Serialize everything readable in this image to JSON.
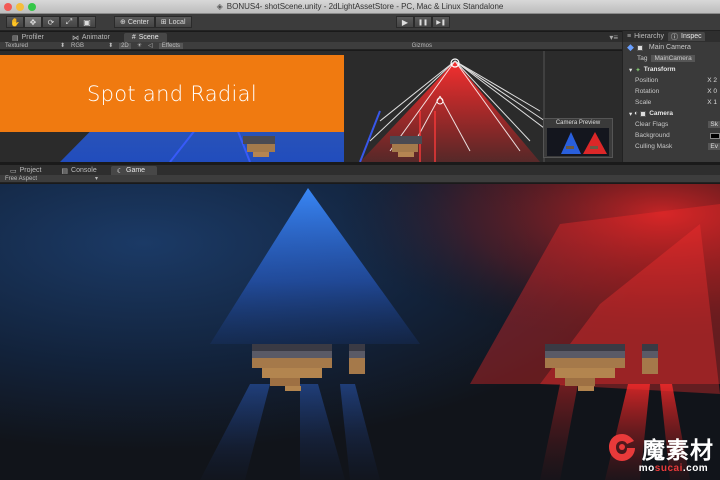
{
  "window": {
    "title": "BONUS4- shotScene.unity - 2dLightAssetStore - PC, Mac & Linux Standalone"
  },
  "toolbar": {
    "tools": [
      "hand-tool",
      "move-tool",
      "rotate-tool",
      "scale-tool",
      "rect-tool"
    ],
    "pivot_label": "Center",
    "space_label": "Local",
    "play_icon": "▶",
    "pause_icon": "❚❚",
    "step_icon": "▶❚"
  },
  "top_tabs": {
    "profiler": "Profiler",
    "animator": "Animator",
    "scene": "Scene"
  },
  "scene_toolbar": {
    "shading": "Textured",
    "render_mode": "RGB",
    "mode_2d": "2D",
    "effects": "Effects",
    "gizmos": "Gizmos"
  },
  "banner": {
    "text": "Spot and Radial"
  },
  "camera_preview": {
    "label": "Camera Preview"
  },
  "right_panel": {
    "tab_hierarchy": "Hierarchy",
    "tab_inspector": "Inspec",
    "object_name": "Main Camera",
    "tag_label": "Tag",
    "tag_value": "MainCamera",
    "transform_label": "Transform",
    "position_label": "Position",
    "position_value": "X 2",
    "rotation_label": "Rotation",
    "rotation_value": "X 0",
    "scale_label": "Scale",
    "scale_value": "X 1",
    "camera_label": "Camera",
    "clear_flags_label": "Clear Flags",
    "clear_flags_value": "Sk",
    "background_label": "Background",
    "culling_mask_label": "Culling Mask",
    "culling_mask_value": "Ev"
  },
  "bottom_tabs": {
    "project": "Project",
    "console": "Console",
    "game": "Game"
  },
  "game_toolbar": {
    "aspect": "Free Aspect"
  },
  "watermark": {
    "cn": "魔素材",
    "url_pre": "mo",
    "url_mid": "sucai",
    "url_post": ".com"
  },
  "colors": {
    "banner": "#f07a10",
    "blue_light": "#2a6bff",
    "red_light": "#ff2a2a"
  }
}
